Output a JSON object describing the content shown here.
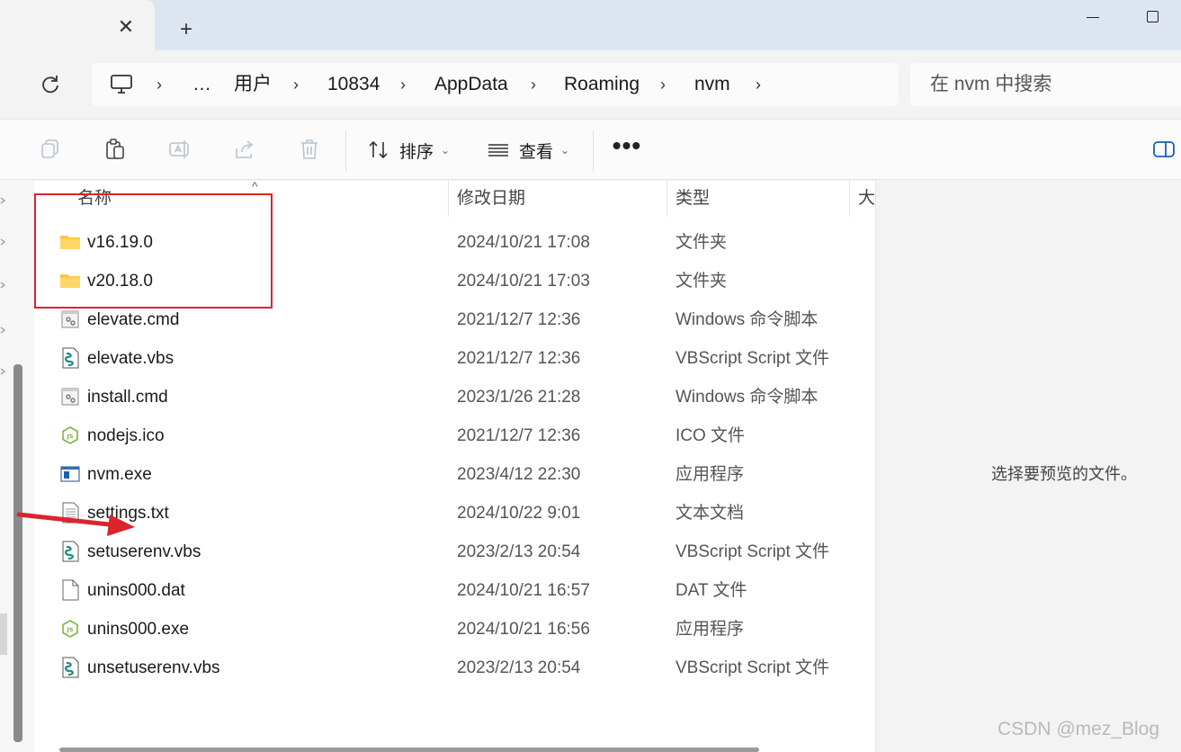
{
  "tabstrip": {
    "close_glyph": "✕",
    "new_tab_glyph": "+"
  },
  "address": {
    "breadcrumbs": [
      "…",
      "用户",
      "10834",
      "AppData",
      "Roaming",
      "nvm"
    ],
    "separator": "›"
  },
  "search": {
    "placeholder": "在 nvm 中搜索"
  },
  "cmdbar": {
    "sort_label": "排序",
    "view_label": "查看",
    "more_label": "•••",
    "caret": "⌄"
  },
  "columns": {
    "name": "名称",
    "modified": "修改日期",
    "type": "类型",
    "size": "大"
  },
  "files": [
    {
      "name": "v16.19.0",
      "date": "2024/10/21 17:08",
      "type": "文件夹",
      "icon": "folder-icon"
    },
    {
      "name": "v20.18.0",
      "date": "2024/10/21 17:03",
      "type": "文件夹",
      "icon": "folder-icon"
    },
    {
      "name": "elevate.cmd",
      "date": "2021/12/7 12:36",
      "type": "Windows 命令脚本",
      "icon": "cmd-file-icon"
    },
    {
      "name": "elevate.vbs",
      "date": "2021/12/7 12:36",
      "type": "VBScript Script 文件",
      "icon": "vbs-file-icon"
    },
    {
      "name": "install.cmd",
      "date": "2023/1/26 21:28",
      "type": "Windows 命令脚本",
      "icon": "cmd-file-icon"
    },
    {
      "name": "nodejs.ico",
      "date": "2021/12/7 12:36",
      "type": "ICO 文件",
      "icon": "nodejs-icon"
    },
    {
      "name": "nvm.exe",
      "date": "2023/4/12 22:30",
      "type": "应用程序",
      "icon": "exe-icon"
    },
    {
      "name": "settings.txt",
      "date": "2024/10/22 9:01",
      "type": "文本文档",
      "icon": "text-file-icon"
    },
    {
      "name": "setuserenv.vbs",
      "date": "2023/2/13 20:54",
      "type": "VBScript Script 文件",
      "icon": "vbs-file-icon"
    },
    {
      "name": "unins000.dat",
      "date": "2024/10/21 16:57",
      "type": "DAT 文件",
      "icon": "blank-file-icon"
    },
    {
      "name": "unins000.exe",
      "date": "2024/10/21 16:56",
      "type": "应用程序",
      "icon": "nodejs-icon"
    },
    {
      "name": "unsetuserenv.vbs",
      "date": "2023/2/13 20:54",
      "type": "VBScript Script 文件",
      "icon": "vbs-file-icon"
    }
  ],
  "preview": {
    "message": "选择要预览的文件。"
  },
  "watermark": "CSDN @mez_Blog",
  "colors": {
    "annotation_red": "#d9252b",
    "folder_yellow": "#f7c948",
    "nodejs_green": "#7cb342"
  }
}
